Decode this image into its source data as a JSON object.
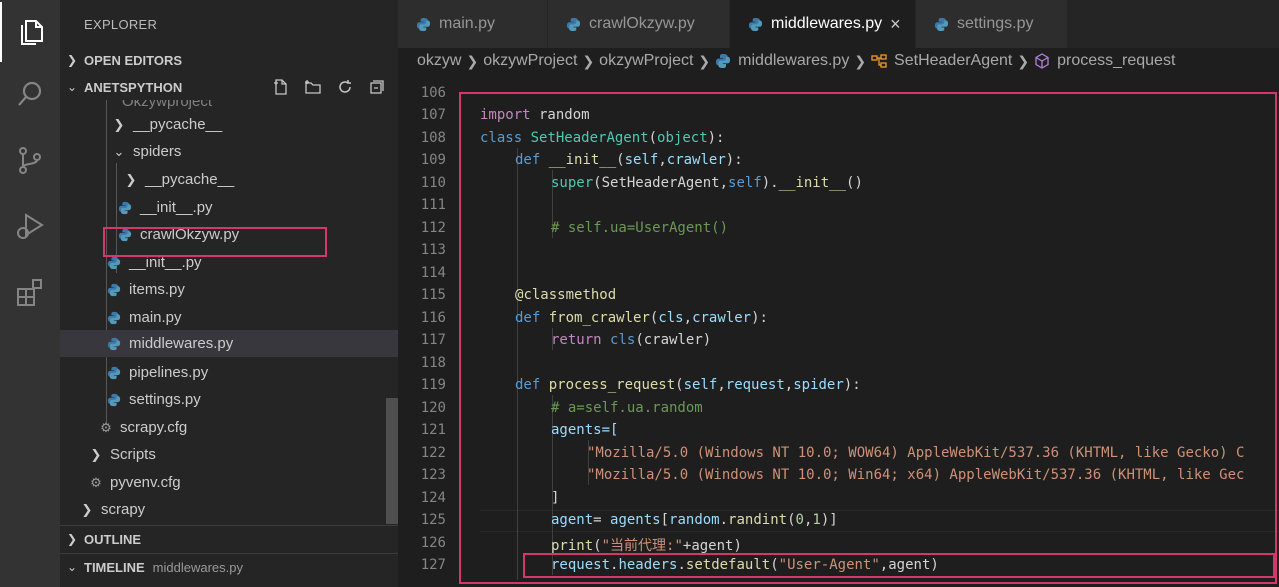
{
  "explorer": {
    "title": "EXPLORER",
    "open_editors": "OPEN EDITORS",
    "workspace": "ANETSPYTHON",
    "outline": "OUTLINE",
    "timeline": "TIMELINE",
    "timeline_file": "middlewares.py",
    "tree": [
      {
        "label": "Okzywproject"
      },
      {
        "label": "__pycache__"
      },
      {
        "label": "spiders"
      },
      {
        "label": "__pycache__"
      },
      {
        "label": "__init__.py"
      },
      {
        "label": "crawlOkzyw.py"
      },
      {
        "label": "__init__.py"
      },
      {
        "label": "items.py"
      },
      {
        "label": "main.py"
      },
      {
        "label": "middlewares.py"
      },
      {
        "label": "pipelines.py"
      },
      {
        "label": "settings.py"
      },
      {
        "label": "scrapy.cfg"
      },
      {
        "label": "Scripts"
      },
      {
        "label": "pyvenv.cfg"
      },
      {
        "label": "scrapy"
      }
    ]
  },
  "tabs": [
    {
      "label": "main.py"
    },
    {
      "label": "crawlOkzyw.py"
    },
    {
      "label": "middlewares.py",
      "close": "×"
    },
    {
      "label": "settings.py"
    }
  ],
  "breadcrumb": [
    "okzyw",
    "okzywProject",
    "okzywProject",
    "middlewares.py",
    "SetHeaderAgent",
    "process_request"
  ],
  "editor": {
    "line_numbers": [
      "106",
      "107",
      "108",
      "109",
      "110",
      "111",
      "112",
      "113",
      "114",
      "115",
      "116",
      "117",
      "118",
      "119",
      "120",
      "121",
      "122",
      "123",
      "124",
      "125",
      "126",
      "127"
    ],
    "l107": [
      "import",
      " random"
    ],
    "l108": [
      "class",
      " ",
      "SetHeaderAgent",
      "(",
      "object",
      "):"
    ],
    "l109": [
      "def",
      " ",
      "__init__",
      "(",
      "self",
      ",",
      "crawler",
      "):"
    ],
    "l110": [
      "super",
      "(SetHeaderAgent,",
      "self",
      ").",
      "__init__",
      "()"
    ],
    "l112": "# self.ua=UserAgent()",
    "l115": [
      "@",
      "classmethod"
    ],
    "l116": [
      "def",
      " ",
      "from_crawler",
      "(",
      "cls",
      ",",
      "crawler",
      "):"
    ],
    "l117": [
      "return",
      " ",
      "cls",
      "(crawler)"
    ],
    "l119": [
      "def",
      " ",
      "process_request",
      "(",
      "self",
      ",",
      "request",
      ",",
      "spider",
      "):"
    ],
    "l120": "# a=self.ua.random",
    "l121": "agents=[",
    "l122": "\"Mozilla/5.0 (Windows NT 10.0; WOW64) AppleWebKit/537.36 (KHTML, like Gecko) C",
    "l123": "\"Mozilla/5.0 (Windows NT 10.0; Win64; x64) AppleWebKit/537.36 (KHTML, like Gec",
    "l124": "]",
    "l125": [
      "agent",
      "= ",
      "agents",
      "[",
      "random",
      ".",
      "randint",
      "(",
      "0",
      ",",
      "1",
      ")]"
    ],
    "l126": [
      "print",
      "(",
      "\"当前代理:\"",
      "+agent)"
    ],
    "l127": [
      "request",
      ".",
      "headers",
      ".",
      "setdefault",
      "(",
      "\"User-Agent\"",
      ",agent)"
    ]
  },
  "colors": {
    "highlight_border": "#d2386c",
    "keyword": "#c586c0",
    "storage": "#569cd6",
    "class": "#4ec9b0",
    "function": "#dcdcaa",
    "string": "#ce9178",
    "comment": "#6a9955"
  },
  "icons": [
    "files-icon",
    "search-icon",
    "source-control-icon",
    "run-debug-icon",
    "extensions-icon",
    "python-file-icon",
    "gear-icon",
    "chevron-right-icon",
    "chevron-down-icon",
    "new-file-icon",
    "new-folder-icon",
    "refresh-icon",
    "collapse-all-icon",
    "close-icon",
    "class-icon",
    "method-icon"
  ]
}
